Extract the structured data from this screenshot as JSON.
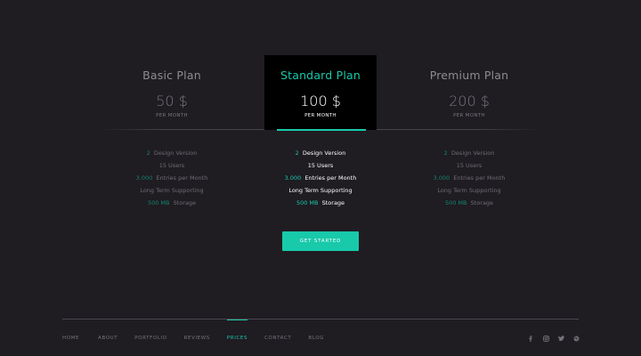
{
  "plans": [
    {
      "name": "Basic Plan",
      "price": "50 $",
      "period": "PER MONTH",
      "features": [
        {
          "num": "2",
          "text": "Design Version"
        },
        {
          "num": "",
          "text": "15 Users"
        },
        {
          "num": "3.000",
          "text": "Entries per Month"
        },
        {
          "num": "",
          "text": "Long Term Supporting"
        },
        {
          "num": "500 MB",
          "text": "Storage"
        }
      ]
    },
    {
      "name": "Standard Plan",
      "price": "100 $",
      "period": "PER MONTH",
      "features": [
        {
          "num": "2",
          "text": "Design Version"
        },
        {
          "num": "",
          "text": "15 Users"
        },
        {
          "num": "3.000",
          "text": "Entries per Month"
        },
        {
          "num": "",
          "text": "Long Term Supporting"
        },
        {
          "num": "500 MB",
          "text": "Storage"
        }
      ]
    },
    {
      "name": "Premium Plan",
      "price": "200 $",
      "period": "PER MONTH",
      "features": [
        {
          "num": "2",
          "text": "Design Version"
        },
        {
          "num": "",
          "text": "15 Users"
        },
        {
          "num": "3.000",
          "text": "Entries per Month"
        },
        {
          "num": "",
          "text": "Long Term Supporting"
        },
        {
          "num": "500 MB",
          "text": "Storage"
        }
      ]
    }
  ],
  "cta": {
    "label": "GET STARTED"
  },
  "footer": {
    "nav": [
      {
        "label": "HOME"
      },
      {
        "label": "ABOUT"
      },
      {
        "label": "PORTFOLIO"
      },
      {
        "label": "REVIEWS"
      },
      {
        "label": "PRICES"
      },
      {
        "label": "CONTACT"
      },
      {
        "label": "BLOG"
      }
    ],
    "active_nav": "PRICES",
    "social": [
      "facebook-icon",
      "instagram-icon",
      "twitter-icon",
      "dribbble-icon"
    ]
  },
  "colors": {
    "background": "#1f1c22",
    "accent": "#18c9aa",
    "highlight_panel": "#000000",
    "muted_text": "#77747b"
  }
}
